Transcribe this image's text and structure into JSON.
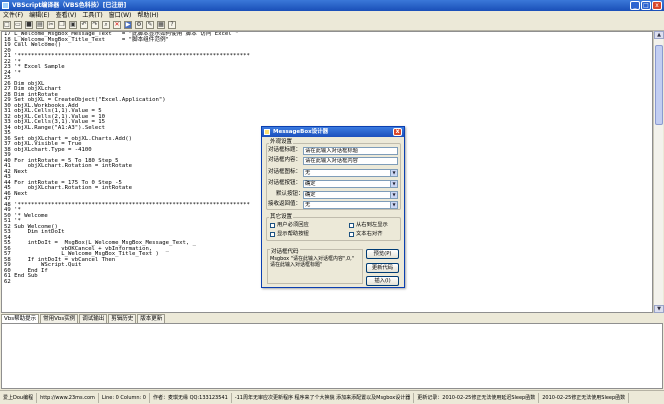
{
  "window": {
    "title": "VBScript编译器（VBS色科技）[已注册]",
    "min": "_",
    "max": "□",
    "close": "x"
  },
  "menu": [
    "文件(F)",
    "编辑(E)",
    "查看(V)",
    "工具(T)",
    "窗口(W)",
    "帮助(H)"
  ],
  "toolbar": [
    {
      "icon": "new-file-icon",
      "glyph": "□"
    },
    {
      "icon": "open-icon",
      "glyph": "▭"
    },
    {
      "icon": "save-icon",
      "glyph": "■"
    },
    {
      "icon": "print-icon",
      "glyph": "▤"
    },
    {
      "icon": "cut-icon",
      "glyph": "✂"
    },
    {
      "icon": "copy-icon",
      "glyph": "❐"
    },
    {
      "icon": "paste-icon",
      "glyph": "▣"
    },
    {
      "icon": "undo-icon",
      "glyph": "↶"
    },
    {
      "icon": "redo-icon",
      "glyph": "↷"
    },
    {
      "icon": "find-icon",
      "glyph": "⌕"
    },
    {
      "icon": "stop-icon",
      "glyph": "✕"
    },
    {
      "icon": "run-icon",
      "glyph": "▶"
    },
    {
      "icon": "debug-icon",
      "glyph": "⚙"
    },
    {
      "icon": "tools-icon",
      "glyph": "✎"
    },
    {
      "icon": "window-icon",
      "glyph": "▦"
    },
    {
      "icon": "help-icon",
      "glyph": "?"
    }
  ],
  "code": [
    "17 L_Welcome_MsgBox_Message_Text   = \"此脚本显示如何使用 脚本 访问 Excel \"",
    "18 L_Welcome_MsgBox_Title_Text     = \"脚本组件范例\"",
    "19 Call Welcome()",
    "20",
    "21 '*********************************************************************",
    "22 '*",
    "23 '* Excel Sample",
    "24 '*",
    "25",
    "26 Dim objXL",
    "27 Dim objXLchart",
    "28 Dim intRotate",
    "29 Set objXL = CreateObject(\"Excel.Application\")",
    "30 objXL.Workbooks.Add",
    "31 objXL.Cells(1,1).Value = 5",
    "32 objXL.Cells(2,1).Value = 10",
    "33 objXL.Cells(3,1).Value = 15",
    "34 objXL.Range(\"A1:A3\").Select",
    "35",
    "36 Set objXLchart = objXL.Charts.Add()",
    "37 objXL.Visible = True",
    "38 objXLchart.Type = -4100",
    "39",
    "40 For intRotate = 5 To 180 Step 5",
    "41     objXLchart.Rotation = intRotate",
    "42 Next",
    "43",
    "44 For intRotate = 175 To 0 Step -5",
    "45     objXLchart.Rotation = intRotate",
    "46 Next",
    "47",
    "48 '*********************************************************************",
    "49 '*",
    "50 '* Welcome",
    "51 '*",
    "52 Sub Welcome()",
    "53     Dim intDoIt",
    "54",
    "55     intDoIt =  MsgBox(L_Welcome_MsgBox_Message_Text, _",
    "56               vbOKCancel + vbInformation,    _",
    "57               L_Welcome_MsgBox_Title_Text )",
    "58     If intDoIt = vbCancel Then",
    "59         WScript.Quit",
    "60     End If",
    "61 End Sub",
    "62"
  ],
  "tabs": [
    "Vbs帮助提示",
    "常用Vbs实例",
    "调试输出",
    "剪辑历史",
    "版本更新"
  ],
  "status": [
    "爱上Dou编程",
    "http://www.23ms.com",
    "Line: 0  Column: 0",
    "作者：麦琪无缘 QQ:133123541",
    "-11周年无审应次更新程序 程序来了个大换貌 添加来添配置以及Msgbox设计器",
    "更新记录：2010-02-25修正无法使用延迟Sleep函数",
    "2010-02-25修正无法使用Sleep函数"
  ],
  "dialog": {
    "title": "MessageBox设计器",
    "close": "x",
    "group1_title": "外观设置",
    "title_label": "对话框标题：",
    "title_value": "请在此输入对话框标题",
    "content_label": "对话框内容：",
    "content_value": "请在此输入对话框内容",
    "icon_label": "对话框图标：",
    "icon_value": "无",
    "button_label": "对话框按钮：",
    "button_value": "确定",
    "default_label": "默认按钮：",
    "default_value": "确定",
    "return_label": "接收返回值：",
    "return_value": "无",
    "group2_title": "其它设置",
    "cb1": "用户必须回应",
    "cb2": "从右到左显示",
    "cb3": "显示帮助按钮",
    "cb4": "文本右对齐",
    "code_title": "对话框代码",
    "code_preview": "Msgbox \"请在此输入对话框内容\",0,\"\n请在此输入对话框标题\"",
    "btn_preview": "预览(P)",
    "btn_update": "更新代码",
    "btn_insert": "插入(I)"
  }
}
